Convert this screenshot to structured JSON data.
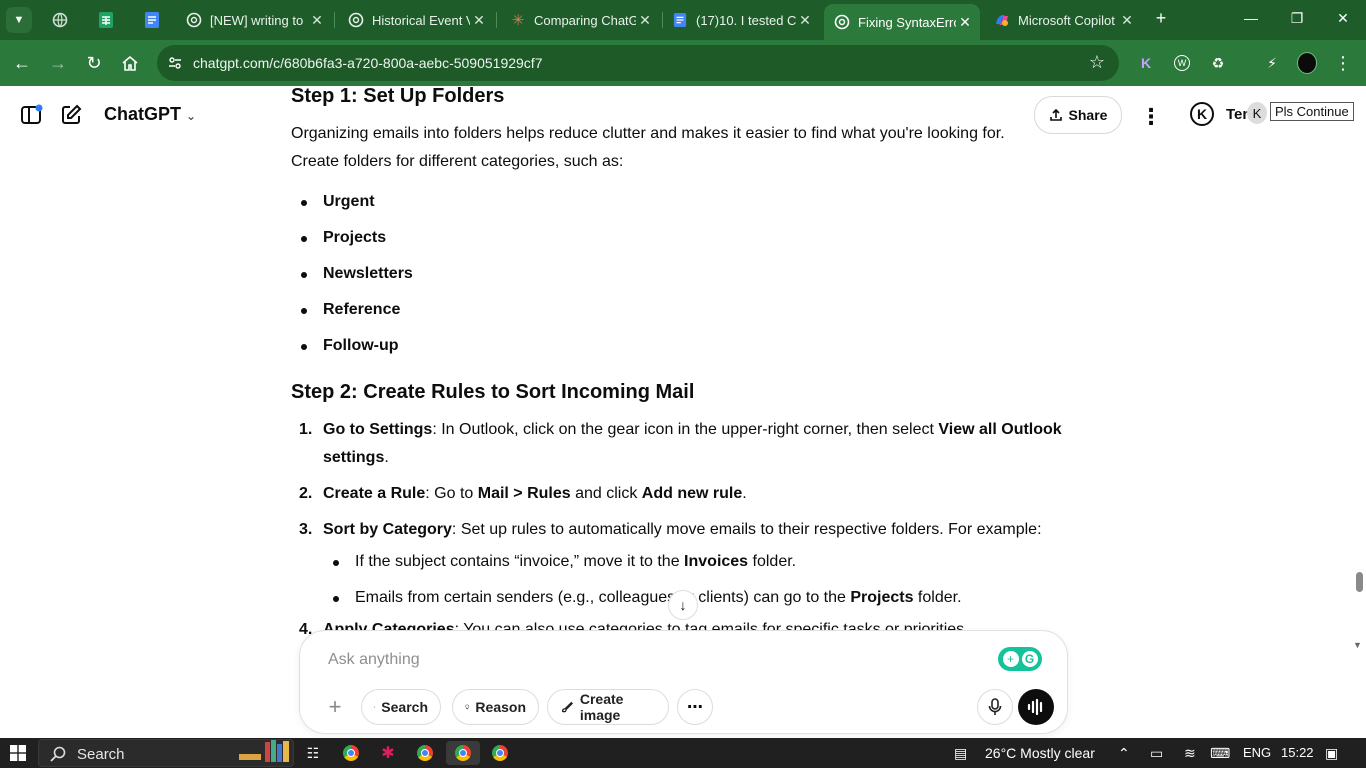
{
  "browser": {
    "tabs": [
      {
        "title": "[NEW] writing to",
        "icon": "chatgpt-icon"
      },
      {
        "title": "Historical Event V",
        "icon": "chatgpt-icon"
      },
      {
        "title": "Comparing ChatG",
        "icon": "claude-icon"
      },
      {
        "title": "(17)10. I tested C",
        "icon": "docs-icon"
      },
      {
        "title": "Fixing SyntaxErro",
        "icon": "chatgpt-icon",
        "active": true
      },
      {
        "title": "Microsoft Copilot",
        "icon": "copilot-icon"
      }
    ],
    "url": "chatgpt.com/c/680b6fa3-a720-800a-aebc-509051929cf7"
  },
  "header": {
    "app_name": "ChatGPT",
    "share_label": "Share",
    "user_name_partial": "Ten",
    "avatar_letter": "K",
    "tooltip": "Pls Continue"
  },
  "article": {
    "step1": {
      "prefix": "Step 1: ",
      "title": "Set Up Folders"
    },
    "intro": "Organizing emails into folders helps reduce clutter and makes it easier to find what you're looking for. Create folders for different categories, such as:",
    "folders": [
      "Urgent",
      "Projects",
      "Newsletters",
      "Reference",
      "Follow-up"
    ],
    "step2": {
      "prefix": "Step 2: ",
      "title": "Create Rules to Sort Incoming Mail"
    },
    "items": [
      {
        "num": "1.",
        "bold": "Go to Settings",
        "text": ": In Outlook, click on the gear icon in the upper-right corner, then select ",
        "bold2": "View all Outlook settings",
        "tail": "."
      },
      {
        "num": "2.",
        "bold": "Create a Rule",
        "text": ": Go to ",
        "b_mail": "Mail > Rules",
        "mid": " and click ",
        "b_add": "Add new rule",
        "tail": "."
      },
      {
        "num": "3.",
        "bold": "Sort by Category",
        "text": ": Set up rules to automatically move emails to their respective folders. For example:"
      }
    ],
    "sub": [
      {
        "pre": "If the subject contains “invoice,” move it to the ",
        "bold": "Invoices",
        "post": " folder."
      },
      {
        "pre": "Emails from certain senders (e.g., colleagues or clients) can go to the ",
        "bold": "Projects",
        "post": " folder."
      }
    ],
    "item4_partial": {
      "num": "4.",
      "bold": "Apply Categories",
      "text": ": You can also use categories to tag emails for specific tasks or priorities."
    }
  },
  "composer": {
    "placeholder": "Ask anything",
    "search": "Search",
    "reason": "Reason",
    "create_image": "Create image"
  },
  "taskbar": {
    "search": "Search",
    "weather": "26°C  Mostly clear",
    "lang": "ENG",
    "time": "15:22"
  }
}
